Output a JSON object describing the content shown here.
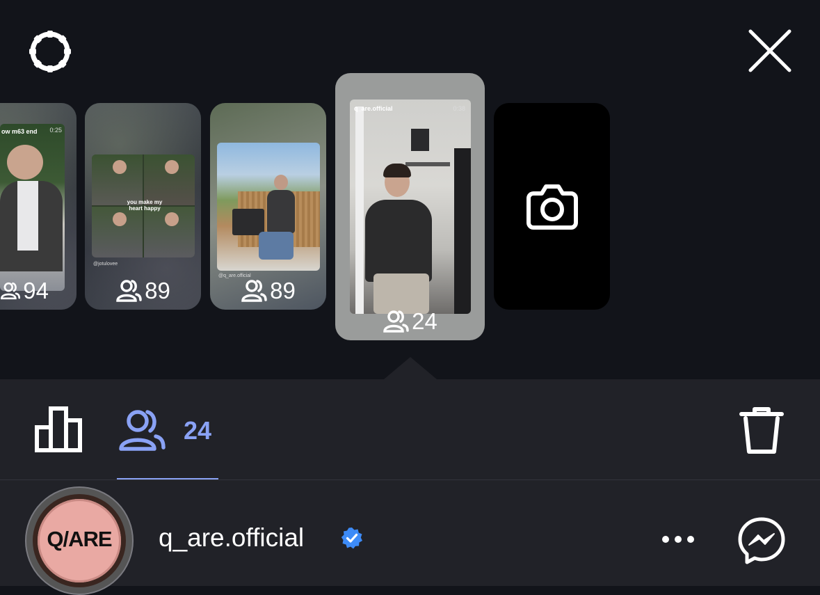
{
  "stories": [
    {
      "viewers": "94",
      "caption": "ow m63 end",
      "time": "0:25"
    },
    {
      "viewers": "89",
      "caption": "you make my heart happy",
      "handle": "@jotulovee"
    },
    {
      "viewers": "89",
      "handle": "@q_are.official"
    },
    {
      "viewers": "24",
      "caption": "q_are.official",
      "time": "0:38"
    }
  ],
  "viewer_tab": {
    "count": "24"
  },
  "profile": {
    "username": "q_are.official",
    "avatar_text": "Q/ARE"
  },
  "colors": {
    "accent": "#8aa2f5",
    "verified": "#3d8bf7",
    "bar": "#212228",
    "background": "#12141a"
  }
}
